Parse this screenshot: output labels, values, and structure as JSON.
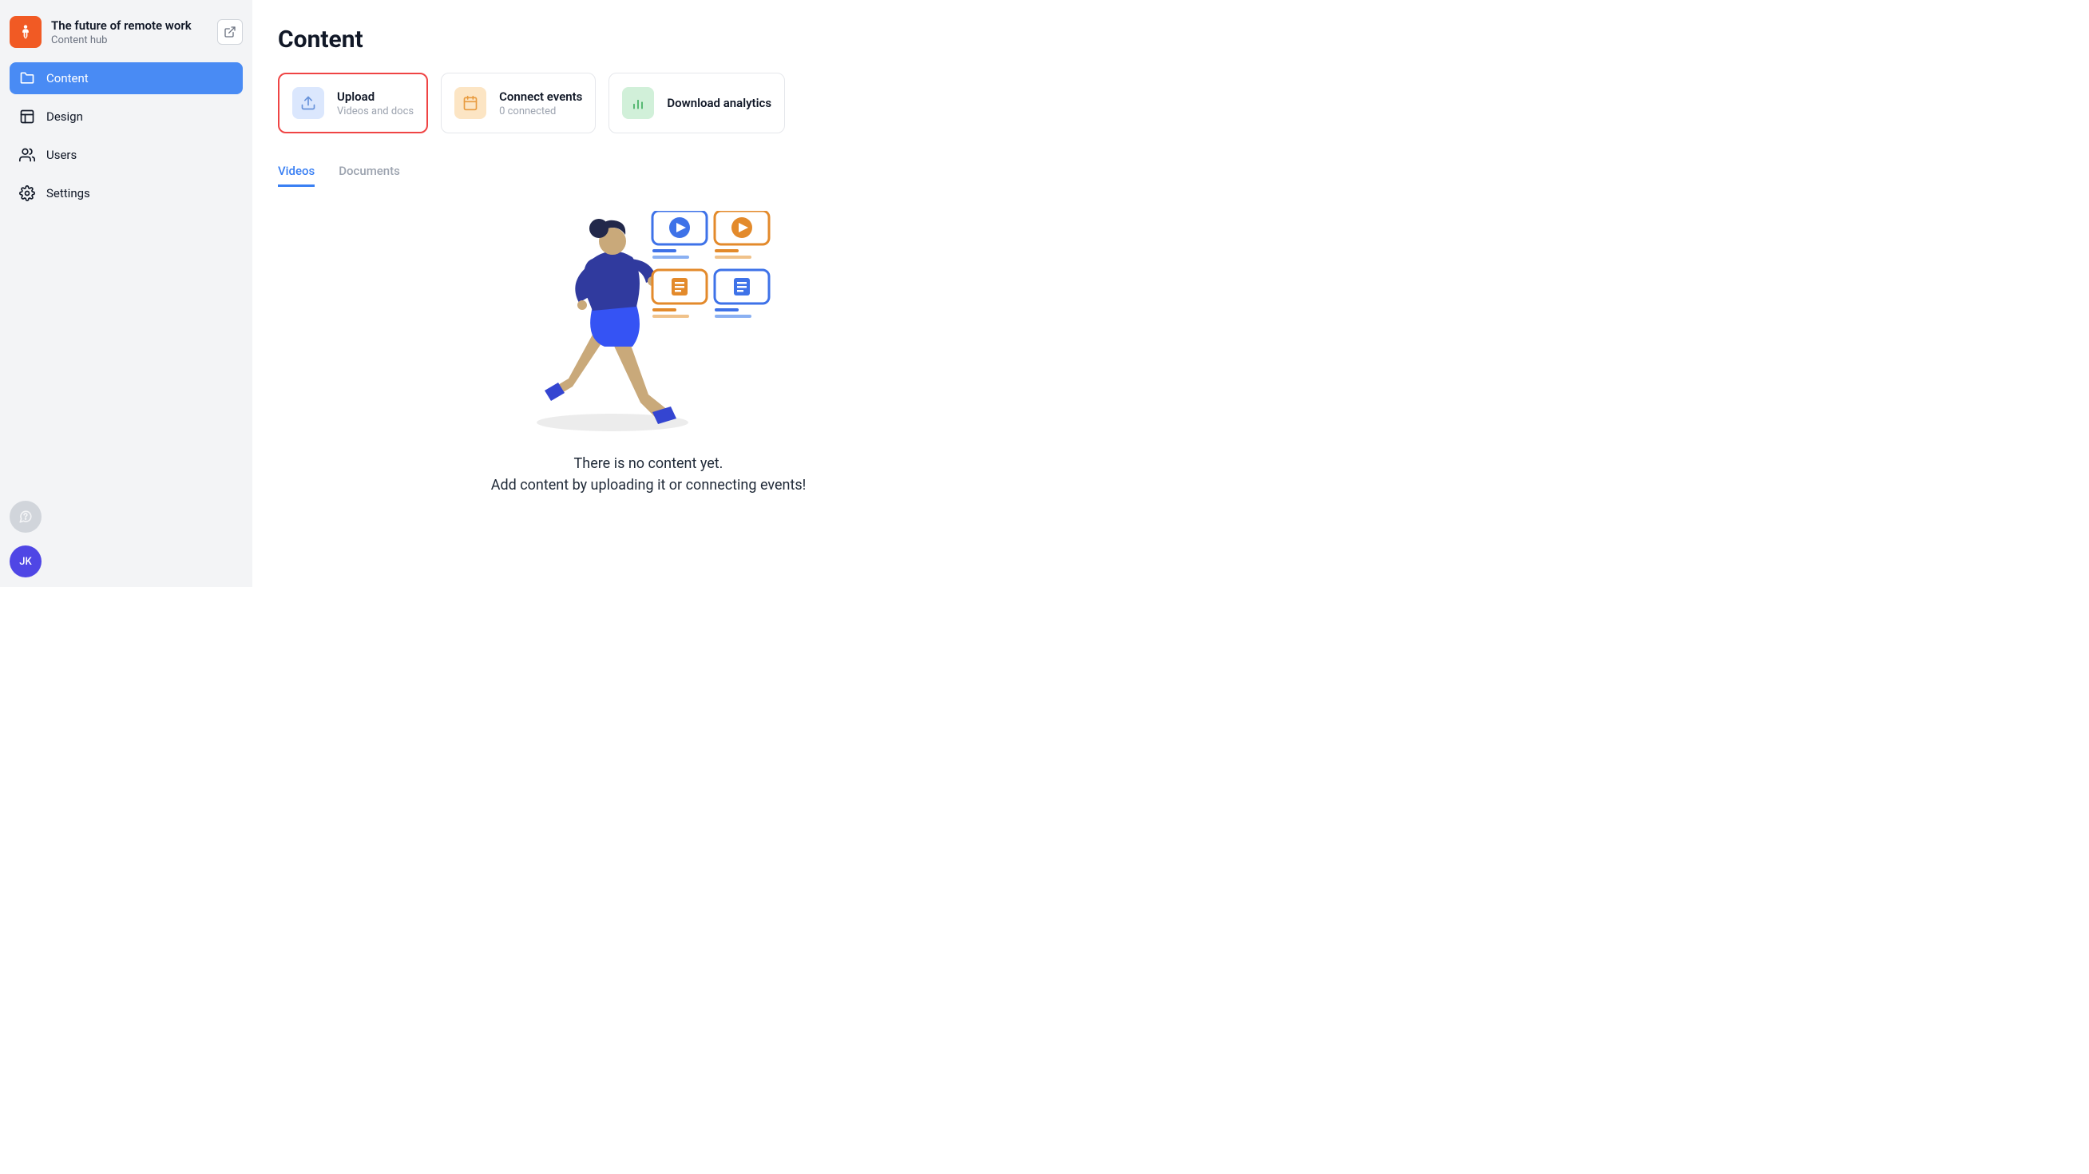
{
  "header": {
    "title": "The future of remote work",
    "subtitle": "Content hub"
  },
  "sidebar": {
    "items": [
      {
        "label": "Content",
        "active": true
      },
      {
        "label": "Design",
        "active": false
      },
      {
        "label": "Users",
        "active": false
      },
      {
        "label": "Settings",
        "active": false
      }
    ]
  },
  "footer": {
    "avatar_initials": "JK"
  },
  "page": {
    "title": "Content"
  },
  "cards": {
    "upload": {
      "title": "Upload",
      "subtitle": "Videos and docs"
    },
    "connect": {
      "title": "Connect events",
      "subtitle": "0 connected"
    },
    "analytics": {
      "title": "Download analytics"
    }
  },
  "tabs": [
    {
      "label": "Videos",
      "active": true
    },
    {
      "label": "Documents",
      "active": false
    }
  ],
  "empty": {
    "line1": "There is no content yet.",
    "line2": "Add content by uploading it or connecting events!"
  }
}
